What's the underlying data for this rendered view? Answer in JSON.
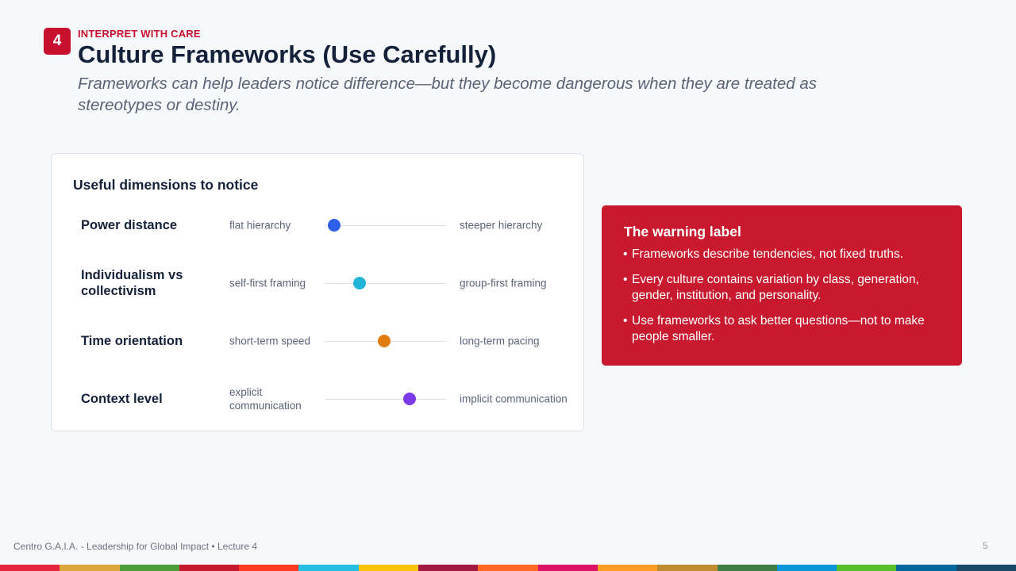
{
  "header": {
    "badge_number": "4",
    "kicker": "INTERPRET WITH CARE",
    "title": "Culture Frameworks (Use Carefully)",
    "subtitle": "Frameworks can help leaders notice difference—but they become dangerous when they are treated as stereotypes or destiny."
  },
  "dimensions": {
    "heading": "Useful dimensions to notice",
    "items": [
      {
        "name": "Power distance",
        "left_pole": "flat hierarchy",
        "right_pole": "steeper hierarchy",
        "position": 0.08,
        "color": "#2f5fe8"
      },
      {
        "name": "Individualism vs collectivism",
        "left_pole": "self-first framing",
        "right_pole": "group-first framing",
        "position": 0.29,
        "color": "#22b3d8"
      },
      {
        "name": "Time orientation",
        "left_pole": "short-term speed",
        "right_pole": "long-term pacing",
        "position": 0.49,
        "color": "#e07d12"
      },
      {
        "name": "Context level",
        "left_pole": "explicit communication",
        "right_pole": "implicit communication",
        "position": 0.7,
        "color": "#7b3be8"
      }
    ]
  },
  "warning": {
    "title": "The warning label",
    "bullet_glyph": "•",
    "items": [
      "Frameworks describe tendencies, not fixed truths.",
      "Every culture contains variation by class, generation, gender, institution, and personality.",
      "Use frameworks to ask better questions—not to make people smaller."
    ]
  },
  "footer": {
    "left": "Centro G.A.I.A. - Leadership for Global Impact • Lecture 4",
    "page": "5"
  },
  "stripe_colors": [
    "#e5243b",
    "#dda63a",
    "#4c9f38",
    "#c5192d",
    "#ff3a21",
    "#26bde2",
    "#fcc30b",
    "#a21942",
    "#fd6925",
    "#dd1367",
    "#fd9d24",
    "#bf8b2e",
    "#3f7e44",
    "#0a97d9",
    "#56c02b",
    "#00689d",
    "#19486a"
  ]
}
